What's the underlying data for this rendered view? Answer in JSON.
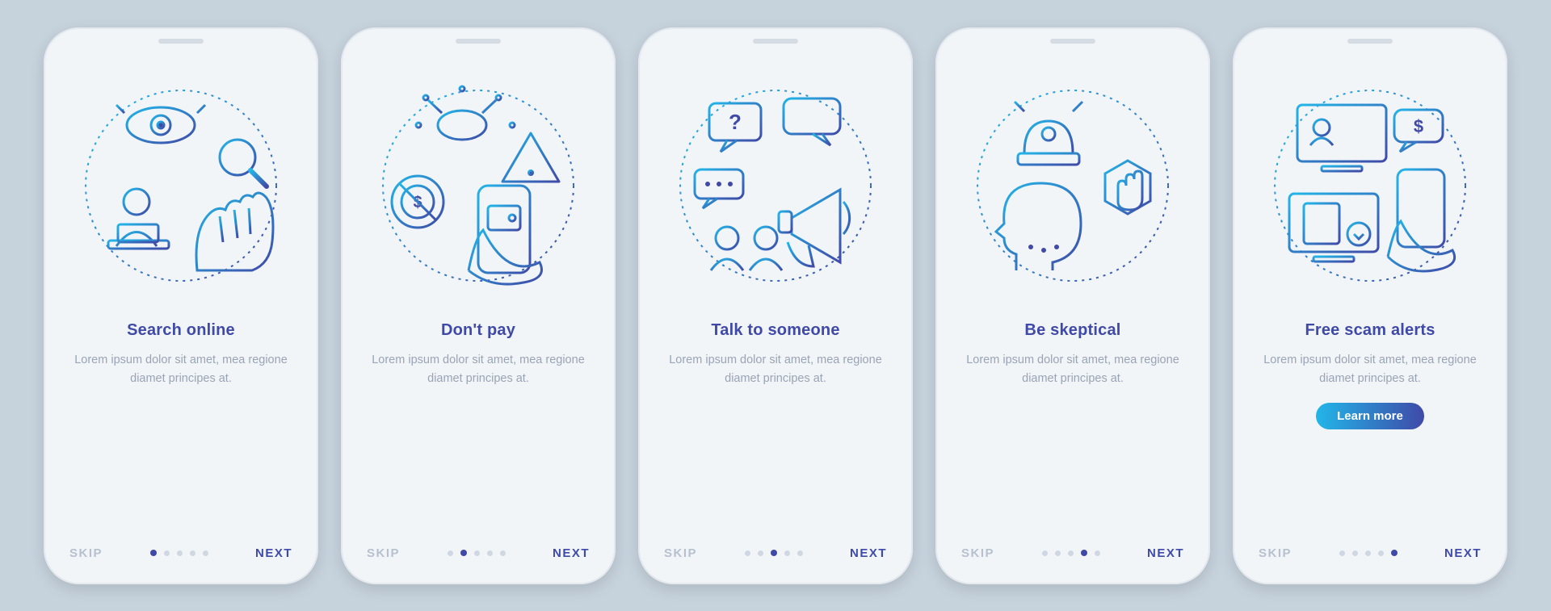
{
  "common": {
    "skip_label": "SKIP",
    "next_label": "NEXT",
    "total_steps": 5,
    "body_text": "Lorem ipsum dolor sit amet, mea regione diamet principes at."
  },
  "screens": [
    {
      "title": "Search online",
      "active_index": 0,
      "has_cta": false,
      "illustration": "search-online",
      "illustration_elements": [
        "eye-icon",
        "magnifier-icon",
        "person-at-laptop-icon",
        "hand-mouse-icon"
      ]
    },
    {
      "title": "Don't pay",
      "active_index": 1,
      "has_cta": false,
      "illustration": "dont-pay",
      "illustration_elements": [
        "circuit-money-icon",
        "warning-icon",
        "no-dollar-icon",
        "hand-phone-wallet-icon"
      ]
    },
    {
      "title": "Talk to someone",
      "active_index": 2,
      "has_cta": false,
      "illustration": "talk-to-someone",
      "illustration_elements": [
        "question-bubble-icon",
        "speech-bubble-icon",
        "dots-bubble-icon",
        "two-people-icon",
        "megaphone-icon"
      ]
    },
    {
      "title": "Be skeptical",
      "active_index": 3,
      "has_cta": false,
      "illustration": "be-skeptical",
      "illustration_elements": [
        "siren-icon",
        "stop-hand-icon",
        "head-exclaim-icon"
      ]
    },
    {
      "title": "Free scam alerts",
      "active_index": 4,
      "has_cta": true,
      "cta_label": "Learn more",
      "illustration": "free-scam-alerts",
      "illustration_elements": [
        "monitor-video-icon",
        "dollar-bubble-icon",
        "hand-phone-lines-icon",
        "monitor-download-icon"
      ]
    }
  ]
}
